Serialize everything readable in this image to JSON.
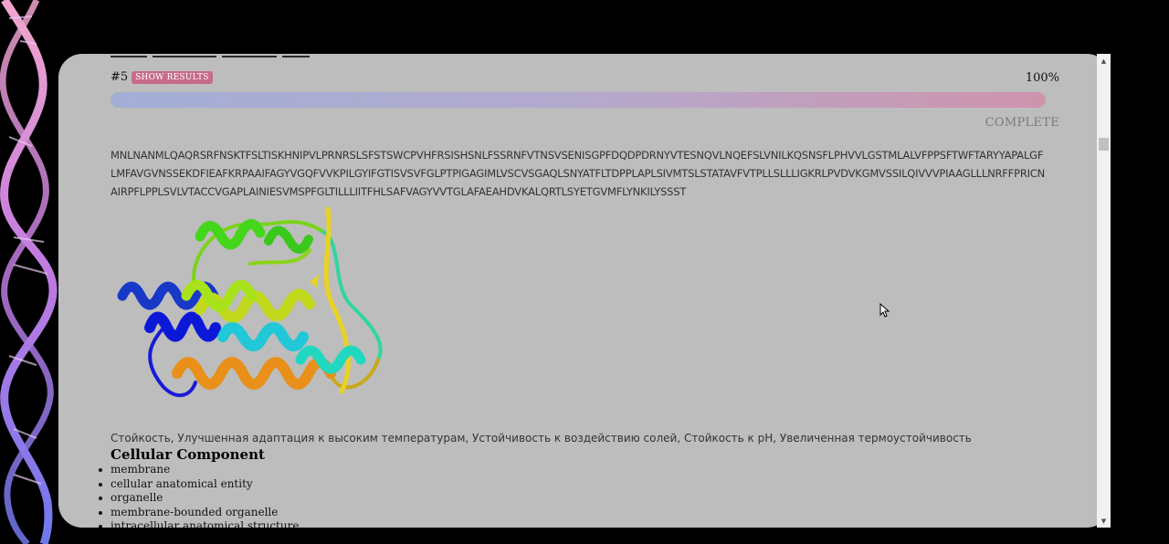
{
  "job": {
    "number": "#5",
    "show_results_label": "SHOW RESULTS",
    "progress_percent_text": "100%",
    "progress_value": 1.0,
    "status": "COMPLETE"
  },
  "sequence": "MNLNANMLQAQRSRFNSKTFSLTISKHNIPVLPRNRSLSFSTSWCPVHFRSISHSNLFSSRNFVTNSVSENISGPFDQDPDRNYVTESNQVLNQEFSLVNILKQSNSFLPHVVLGSTMLALVFPPSFTWFTARYYAPALGFLMFAVGVNSSEKDFIEAFKRPAAIFAGYVGQFVVKPILGYIFGTISVSVFGLPTPIGAGIMLVSCVSGAQLSNYATFLTDPPLAPLSIVMTSLSTATAVFVTPLLSLLLIGKRLPVDVKGMVSSILQIVVVPIAAGLLLNRFFPRICNAIRPFLPPLSVLVTACCVGAPLAINIESVMSPFGLTILLLIITFHLSAFVAGYVVTGLAFAEAHDVKALQRTLSYETGVMFLYNKILYSSST",
  "properties": "Стойкость, Улучшенная адаптация к высоким температурам, Устойчивость к воздействию солей, Стойкость к pH, Увеличенная термоустойчивость",
  "cellular_component": {
    "title": "Cellular Component",
    "items": [
      "membrane",
      "cellular anatomical entity",
      "organelle",
      "membrane-bounded organelle",
      "intracellular anatomical structure"
    ]
  },
  "colors": {
    "badge": "#c76b8b",
    "progress_start": "#a3aed6",
    "progress_end": "#cf94ac",
    "panel": "#bdbdbd"
  },
  "icons": {
    "scroll_up": "triangle-up-icon",
    "scroll_down": "triangle-down-icon",
    "cursor": "mouse-pointer-icon"
  }
}
